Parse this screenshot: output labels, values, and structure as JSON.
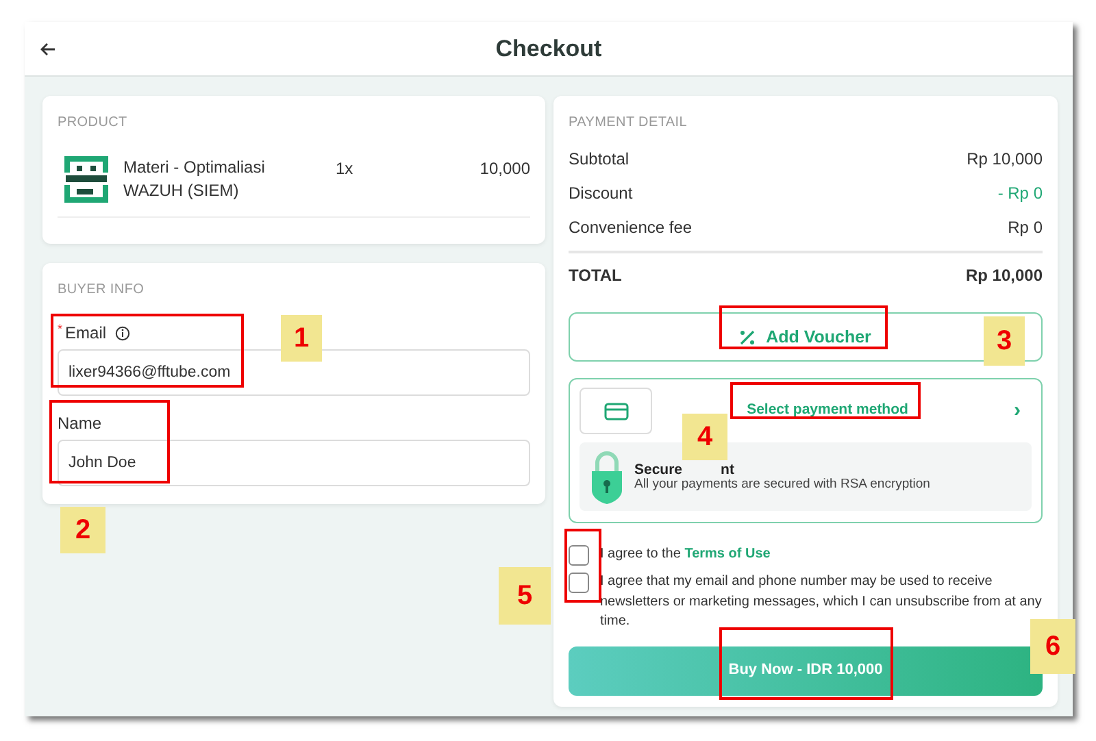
{
  "header": {
    "title": "Checkout"
  },
  "product": {
    "heading": "PRODUCT",
    "items": [
      {
        "name": "Materi - Optimaliasi WAZUH (SIEM)",
        "quantity": "1x",
        "price": "10,000"
      }
    ]
  },
  "buyer_info": {
    "heading": "BUYER INFO",
    "fields": [
      {
        "label": "Email",
        "required_mark": "*",
        "info": true,
        "value": "lixer94366@fftube.com"
      },
      {
        "label": "Name",
        "info": false,
        "value": "John Doe"
      }
    ]
  },
  "payment_detail": {
    "heading": "PAYMENT DETAIL",
    "rows": [
      {
        "label": "Subtotal",
        "value": "Rp 10,000",
        "kind": "normal"
      },
      {
        "label": "Discount",
        "value": "- Rp 0",
        "kind": "discount"
      },
      {
        "label": "Convenience fee",
        "value": "Rp 0",
        "kind": "normal"
      }
    ],
    "total": {
      "label": "TOTAL",
      "value": "Rp 10,000"
    },
    "voucher_button": "Add Voucher",
    "payment_method": {
      "label": "Select payment method",
      "chevron": "›",
      "secure_title_start": "Secure",
      "secure_title_end": "nt",
      "secure_text": "All your payments are secured with RSA encryption"
    },
    "agreements": [
      {
        "text": "I agree to the ",
        "link": "Terms of Use",
        "checked": false
      },
      {
        "text": "I agree that my email and phone number may be used to receive newsletters or marketing messages, which I can unsubscribe from at any time.",
        "checked": false
      }
    ],
    "buy_button": "Buy Now - IDR 10,000"
  },
  "annotations": [
    {
      "number": "1"
    },
    {
      "number": "2"
    },
    {
      "number": "3"
    },
    {
      "number": "4"
    },
    {
      "number": "5"
    },
    {
      "number": "6"
    }
  ]
}
